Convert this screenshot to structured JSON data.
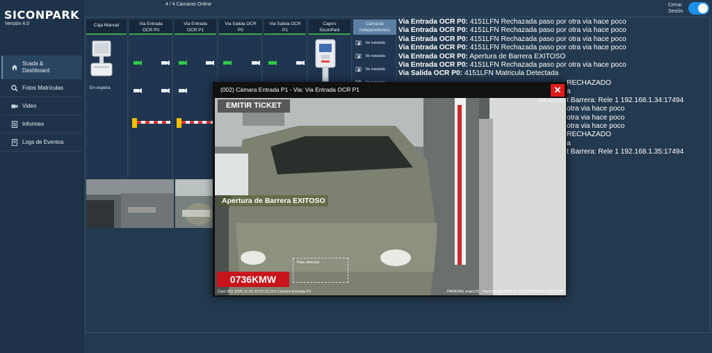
{
  "app": {
    "logo": "SICONPARK",
    "version": "Versión 4.0"
  },
  "header": {
    "cameras_online": "4 / 4 Cámaras Online",
    "logout_line1": "Cerrar",
    "logout_line2": "Sesión"
  },
  "sidebar": {
    "items": [
      {
        "label": "Scada & Dashboard",
        "icon": "home-icon"
      },
      {
        "label": "Fotos Matrículas",
        "icon": "search-icon"
      },
      {
        "label": "Video",
        "icon": "video-icon"
      },
      {
        "label": "Informes",
        "icon": "document-icon"
      },
      {
        "label": "Logs de Eventos",
        "icon": "list-icon"
      }
    ]
  },
  "columns": {
    "caja_manual": "Caja Manual",
    "caja_status": "En espera",
    "entrada_p0": [
      "Via Entrada",
      "OCR P0"
    ],
    "entrada_p1": [
      "Via Entrada",
      "OCR P1"
    ],
    "salida_p0": [
      "Via Salida OCR",
      "P0"
    ],
    "salida_p1": [
      "Via Salida OCR",
      "P1"
    ],
    "cajero": [
      "Cajero",
      "SiconPark"
    ],
    "independientes": [
      "Cámaras",
      "independientes"
    ],
    "indep_status": [
      "No instalada",
      "No instalada",
      "No instalada",
      "No instalada"
    ]
  },
  "log": [
    {
      "bold": "Via Entrada OCR P0:",
      "text": " 4151LFN Rechazada paso por otra via hace poco"
    },
    {
      "bold": "Via Entrada OCR P0:",
      "text": " 4151LFN Rechazada paso por otra via hace poco"
    },
    {
      "bold": "Via Entrada OCR P0:",
      "text": " 4151LFN Rechazada paso por otra via hace poco"
    },
    {
      "bold": "Via Entrada OCR P0:",
      "text": " 4151LFN Rechazada paso por otra via hace poco"
    },
    {
      "bold": "Via Entrada OCR P0:",
      "text": " Apertura de Barrera EXITOSO"
    },
    {
      "bold": "Via Entrada OCR P0:",
      "text": " 4151LFN Rechazada paso por otra via hace poco"
    },
    {
      "bold": "Via Salida OCR P0:",
      "text": " 4151LFN Matricula Detectada"
    }
  ],
  "log_partial": [
    "RECHAZADO",
    "a",
    "t Barrera: Rele 1 192.168.1.34:17494",
    "otra via hace poco",
    "otra via hace poco",
    "otra via hace poco",
    "RECHAZADO",
    "a",
    "t Barrera: Rele 1 192.168.1.35:17494"
  ],
  "video": {
    "title": "(002) Cámara Entrada P1 - Via: Via Entrada OCR P1",
    "emit_ticket": "EMITIR TICKET",
    "lpr_status": "LPR ACTIVO",
    "overlay_message": "Apertura de Barrera EXITOSO",
    "plate_detected": "Plate detected",
    "plate": "0736KMW",
    "footer_left": "Cam 002  2020.11.03  10:52:23.114  Cámara Entrada P1",
    "footer_right": "PARKING enam70 - Via Entrada OCR P1     ©SICONPARK.COM 2020"
  }
}
